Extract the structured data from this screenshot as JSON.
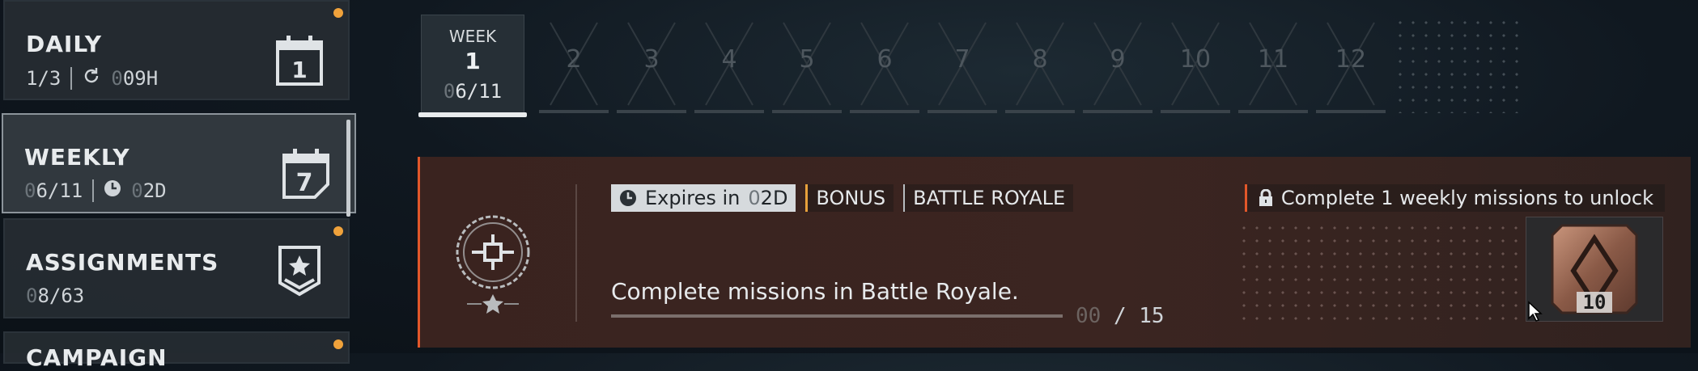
{
  "sidebar": {
    "items": [
      {
        "title": "DAILY",
        "progress": "1/3",
        "timer": "09H",
        "timer_dim": "",
        "icon_number": "1",
        "has_new": true
      },
      {
        "title": "WEEKLY",
        "progress_dim": "0",
        "progress": "6/11",
        "timer_dim": "0",
        "timer": "2D",
        "icon_number": "7",
        "has_new": false
      },
      {
        "title": "ASSIGNMENTS",
        "progress_dim": "0",
        "progress": "8/63",
        "has_new": true
      },
      {
        "title": "CAMPAIGN",
        "has_new": true
      }
    ]
  },
  "weeks": {
    "active": {
      "label": "WEEK",
      "number": "1",
      "progress_dim": "0",
      "progress": "6/11"
    },
    "locked": [
      "2",
      "3",
      "4",
      "5",
      "6",
      "7",
      "8",
      "9",
      "10",
      "11",
      "12"
    ]
  },
  "mission": {
    "tags": {
      "expires_label": "Expires in",
      "expires_dim": "0",
      "expires_value": "2D",
      "bonus": "BONUS",
      "mode": "BATTLE ROYALE"
    },
    "lock_text": "Complete 1 weekly missions to unlock",
    "description": "Complete missions in Battle Royale.",
    "progress_dim": "00",
    "progress_total": "/ 15",
    "progress_fraction": 0,
    "reward_amount": "10"
  },
  "colors": {
    "accent_orange": "#e2572a",
    "notification_dot": "#f0a23b",
    "bonus_bar": "#e8a13b"
  }
}
